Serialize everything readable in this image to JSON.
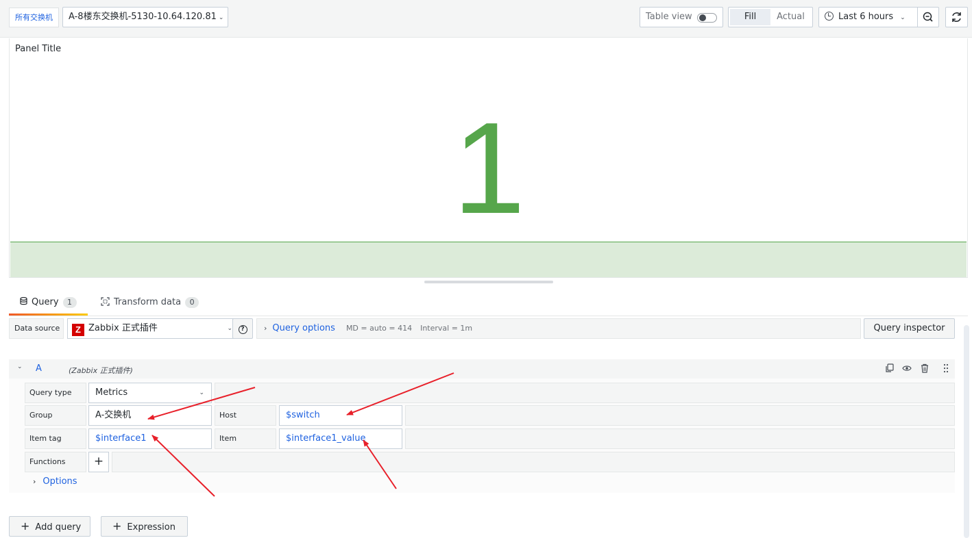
{
  "toolbar": {
    "variable_label": "所有交换机",
    "variable_value": "A-8楼东交换机-5130-10.64.120.81",
    "table_view_label": "Table view",
    "fill_label": "Fill",
    "actual_label": "Actual",
    "time_range_label": "Last 6 hours"
  },
  "panel": {
    "title": "Panel Title",
    "stat_value": "1"
  },
  "tabs": [
    {
      "label": "Query",
      "count": "1"
    },
    {
      "label": "Transform data",
      "count": "0"
    }
  ],
  "datasource": {
    "label": "Data source",
    "logo_letter": "Z",
    "name": "Zabbix 正式插件",
    "query_options_label": "Query options",
    "md_text": "MD = auto = 414",
    "interval_text": "Interval = 1m",
    "inspector_label": "Query inspector"
  },
  "query": {
    "ref_id": "A",
    "ds_name": "(Zabbix 正式插件)",
    "query_type_label": "Query type",
    "query_type_value": "Metrics",
    "group_label": "Group",
    "group_value": "A-交换机",
    "host_label": "Host",
    "host_value": "$switch",
    "item_tag_label": "Item tag",
    "item_tag_value": "$interface1",
    "item_label": "Item",
    "item_value": "$interface1_value",
    "functions_label": "Functions",
    "options_label": "Options"
  },
  "actions": {
    "add_query": "Add query",
    "expression": "Expression"
  },
  "colors": {
    "accent_blue": "#1f62e0",
    "stat_green": "#56a64b",
    "annotation_red": "#e8202a"
  }
}
